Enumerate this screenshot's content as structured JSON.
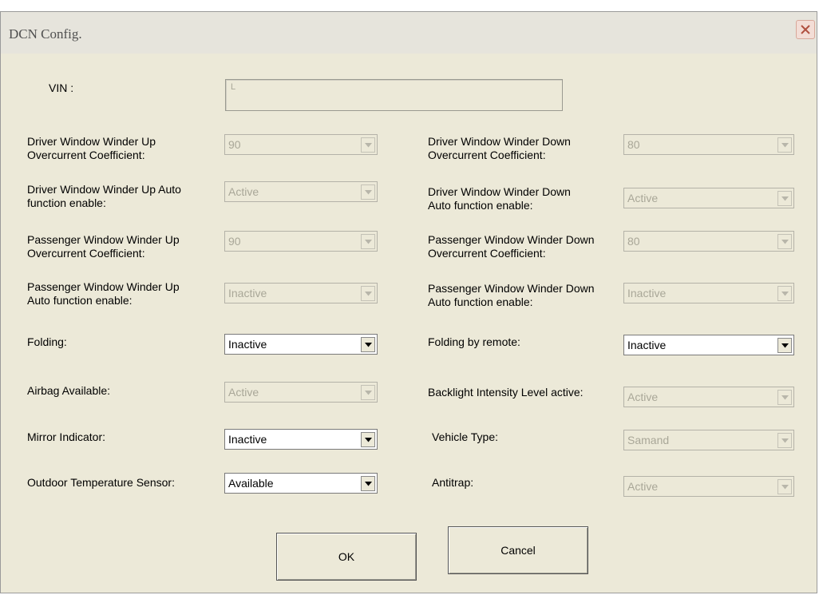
{
  "window": {
    "title": "DCN Config."
  },
  "vin": {
    "label": "VIN :",
    "value": "L"
  },
  "rows": [
    {
      "left": {
        "label": "Driver Window Winder Up\nOvercurrent Coefficient:",
        "value": "90"
      },
      "right": {
        "label": "Driver Window Winder Down\nOvercurrent Coefficient:",
        "value": "80"
      }
    },
    {
      "left": {
        "label": "Driver Window Winder Up Auto\nfunction enable:",
        "value": "Active"
      },
      "right": {
        "label": "Driver Window Winder Down\nAuto function enable:",
        "value": "Active"
      }
    },
    {
      "left": {
        "label": "Passenger Window Winder Up\nOvercurrent Coefficient:",
        "value": "90"
      },
      "right": {
        "label": "Passenger Window Winder Down\n Overcurrent Coefficient:",
        "value": "80"
      }
    },
    {
      "left": {
        "label": "Passenger Window Winder Up\nAuto function enable:",
        "value": "Inactive"
      },
      "right": {
        "label": "Passenger Window Winder Down\n Auto function enable:",
        "value": "Inactive"
      }
    },
    {
      "left": {
        "label": "Folding:",
        "value": "Inactive"
      },
      "right": {
        "label": "Folding by remote:",
        "value": "Inactive"
      }
    },
    {
      "left": {
        "label": "Airbag  Available:",
        "value": "Active"
      },
      "right": {
        "label": "Backlight Intensity Level active:",
        "value": "Active"
      }
    },
    {
      "left": {
        "label": "Mirror Indicator:",
        "value": "Inactive"
      },
      "right": {
        "label": "Vehicle Type:",
        "value": "Samand"
      }
    },
    {
      "left": {
        "label": " Outdoor Temperature Sensor:",
        "value": "Available"
      },
      "right": {
        "label": "Antitrap:",
        "value": "Active"
      }
    }
  ],
  "buttons": {
    "ok": "OK",
    "cancel": "Cancel"
  },
  "icons": {
    "close": "close-icon",
    "dropdown": "chevron-down-icon"
  },
  "colors": {
    "window_bg": "#ece9d8",
    "close_button": "#f3ddd6",
    "disabled_text": "#a9a798"
  }
}
